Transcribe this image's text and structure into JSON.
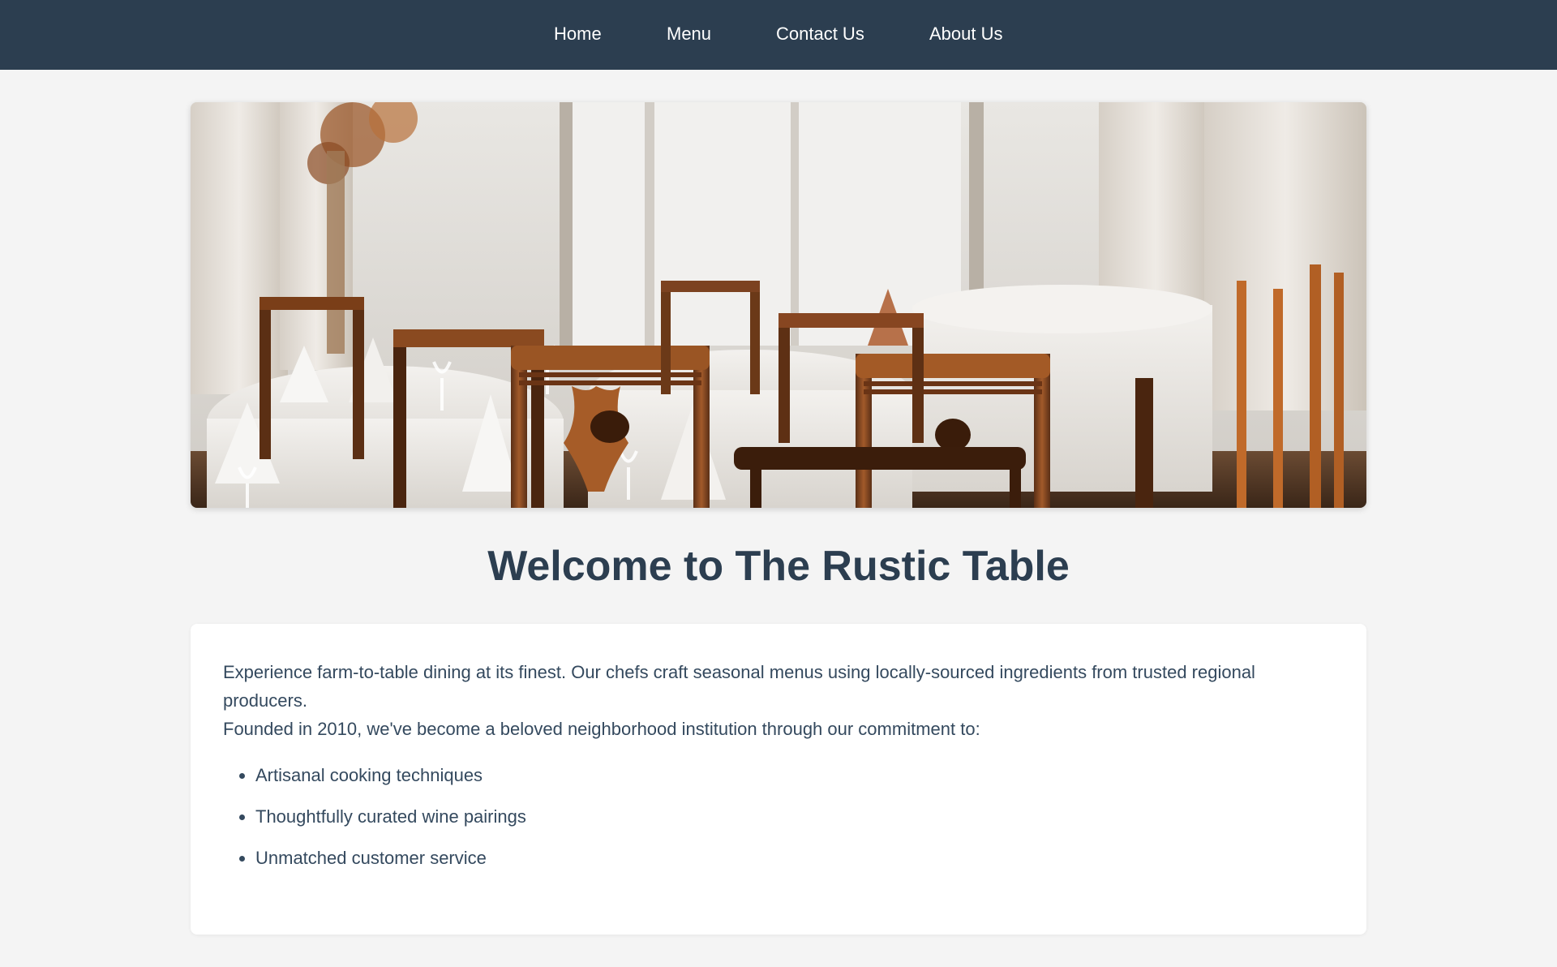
{
  "nav": {
    "items": [
      {
        "label": "Home"
      },
      {
        "label": "Menu"
      },
      {
        "label": "Contact Us"
      },
      {
        "label": "About Us"
      }
    ]
  },
  "hero": {
    "image_subject": "restaurant dining room with wooden chairs and tables set with white tablecloths and folded napkins"
  },
  "main": {
    "title": "Welcome to The Rustic Table",
    "intro": "Experience farm-to-table dining at its finest. Our chefs craft seasonal menus using locally-sourced ingredients from trusted regional producers.",
    "founded": "Founded in 2010, we've become a beloved neighborhood institution through our commitment to:",
    "features": [
      "Artisanal cooking techniques",
      "Thoughtfully curated wine pairings",
      "Unmatched customer service"
    ]
  },
  "colors": {
    "nav_background": "#2c3e50",
    "page_background": "#f4f4f4",
    "title_color": "#2c3e50",
    "text_color": "#34495e",
    "card_background": "#ffffff"
  }
}
